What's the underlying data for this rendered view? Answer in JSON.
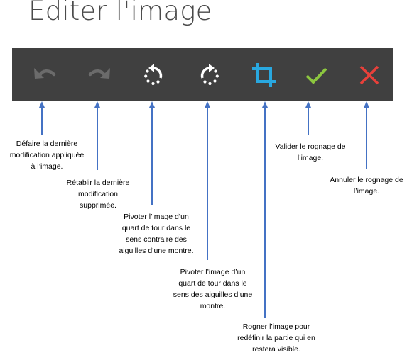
{
  "page": {
    "title": "Editer l'image"
  },
  "toolbar": {
    "buttons": [
      {
        "name": "undo",
        "icon": "undo-icon",
        "color": "#6b6b6b",
        "enabled": false
      },
      {
        "name": "redo",
        "icon": "redo-icon",
        "color": "#6b6b6b",
        "enabled": false
      },
      {
        "name": "rotate-left",
        "icon": "rotate-counterclockwise-icon",
        "color": "#ffffff",
        "enabled": true
      },
      {
        "name": "rotate-right",
        "icon": "rotate-clockwise-icon",
        "color": "#ffffff",
        "enabled": true
      },
      {
        "name": "crop",
        "icon": "crop-icon",
        "color": "#29a8e0",
        "enabled": true
      },
      {
        "name": "validate",
        "icon": "checkmark-icon",
        "color": "#8cc63f",
        "enabled": true
      },
      {
        "name": "cancel",
        "icon": "close-icon",
        "color": "#e8403a",
        "enabled": true
      }
    ],
    "background": "#404040"
  },
  "callouts": {
    "undo": "Défaire la dernière\nmodification appliquée\nà l’image.",
    "redo": "Rétablir la dernière\nmodification\nsupprimée.",
    "rotate_left": "Pivoter l’image d’un\nquart de tour dans le\nsens contraire des\naiguilles d’une montre.",
    "rotate_right": "Pivoter l’image d’un\nquart de tour dans le\nsens des aiguilles d’une\nmontre.",
    "crop": "Rogner l’image pour\nredéfinir la partie qui en\nrestera visible.",
    "validate": "Valider le rognage de\nl’image.",
    "cancel": "Annuler le rognage de\nl’image."
  },
  "colors": {
    "arrow": "#4472c4",
    "title": "#4a4a4a"
  }
}
